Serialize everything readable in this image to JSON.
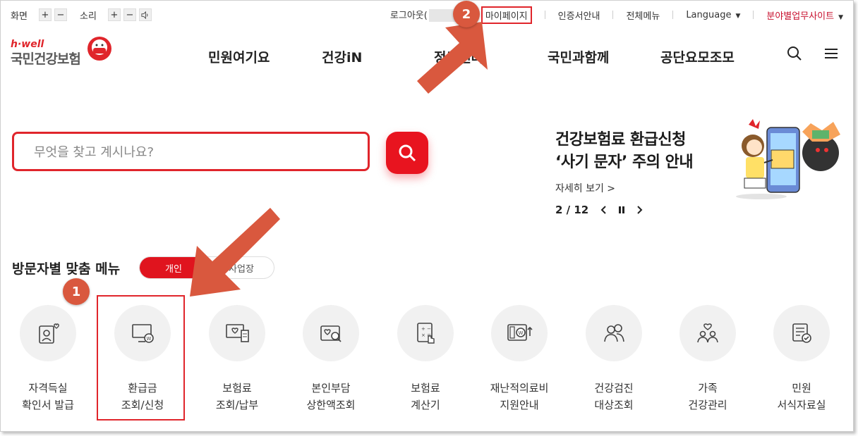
{
  "util": {
    "screen_label": "화면",
    "sound_label": "소리",
    "plus": "+",
    "minus": "−",
    "logout": "로그아웃(",
    "mypage": "마이페이지",
    "cert": "인증서안내",
    "allmenu": "전체메뉴",
    "language": "Language",
    "field_sites": "분야별업무사이트"
  },
  "logo": {
    "tag": "h·well",
    "name": "국민건강보험"
  },
  "gnb": [
    "민원여기요",
    "건강iN",
    "정보센터",
    "국민과함께",
    "공단요모조모"
  ],
  "search": {
    "placeholder": "무엇을 찾고 계시나요?"
  },
  "banner": {
    "line1": "건강보험료 환급신청",
    "line2": "‘사기 문자’ 주의 안내",
    "more": "자세히 보기 >",
    "counter": "2 / 12"
  },
  "visitor_menu": {
    "title": "방문자별 맞춤 메뉴",
    "tab_personal": "개인",
    "tab_business": "사업장",
    "items": [
      {
        "line1": "자격득실",
        "line2": "확인서 발급",
        "icon": "id-card-heart-icon"
      },
      {
        "line1": "환급금",
        "line2": "조회/신청",
        "icon": "monitor-won-icon"
      },
      {
        "line1": "보험료",
        "line2": "조회/납부",
        "icon": "monitor-receipt-icon"
      },
      {
        "line1": "본인부담",
        "line2": "상한액조회",
        "icon": "heart-search-icon"
      },
      {
        "line1": "보험료",
        "line2": "계산기",
        "icon": "calculator-icon"
      },
      {
        "line1": "재난적의료비",
        "line2": "지원안내",
        "icon": "won-support-icon"
      },
      {
        "line1": "건강검진",
        "line2": "대상조회",
        "icon": "people-checkup-icon"
      },
      {
        "line1": "가족",
        "line2": "건강관리",
        "icon": "family-heart-icon"
      },
      {
        "line1": "민원",
        "line2": "서식자료실",
        "icon": "document-check-icon"
      }
    ]
  },
  "annotations": {
    "step1": "1",
    "step2": "2"
  },
  "colors": {
    "brand_red": "#e0141e",
    "arrow": "#d9583e"
  }
}
